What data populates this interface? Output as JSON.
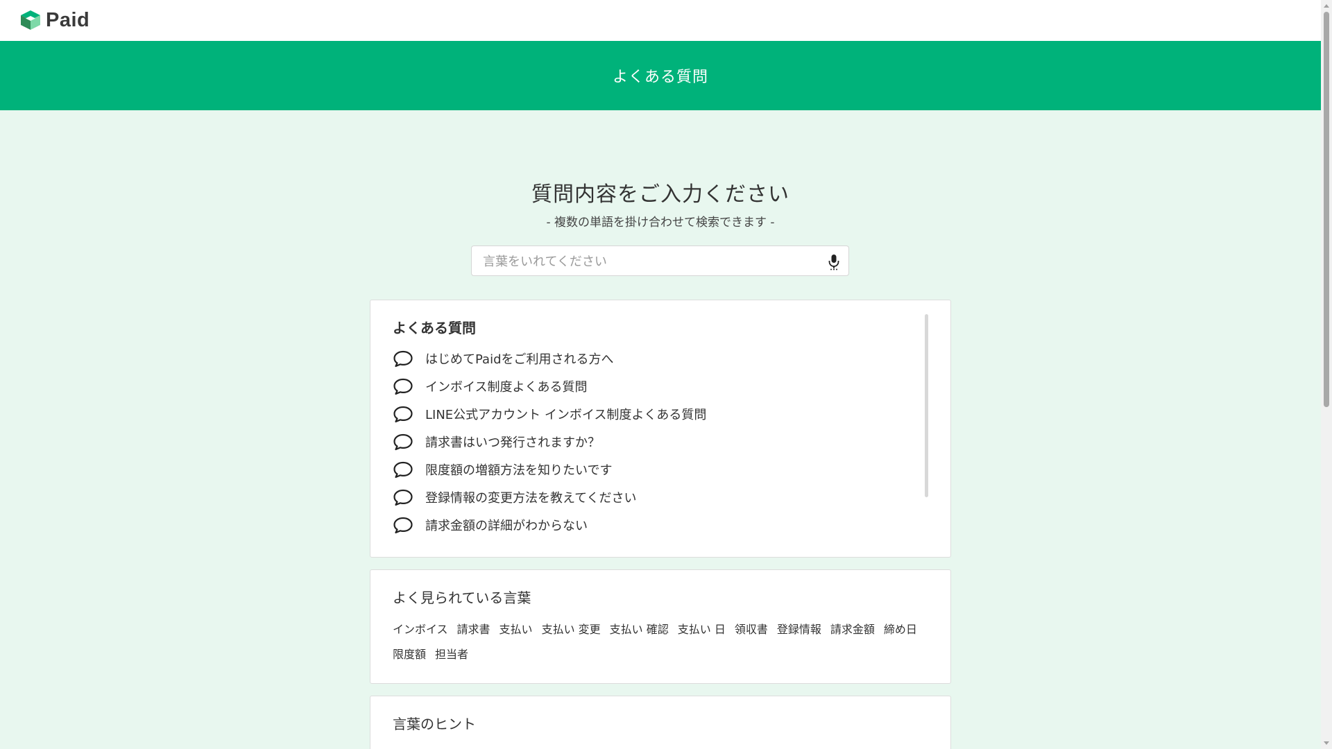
{
  "app": {
    "logo_text": "Paid",
    "brand_color": "#00b27a",
    "background_color": "#e8f7ef"
  },
  "header": {
    "title": "よくある質問"
  },
  "search": {
    "title": "質問内容をご入力ください",
    "subtitle": "- 複数の単語を掛け合わせて検索できます -",
    "placeholder": "言葉をいれてください",
    "value": "",
    "mic_icon": "microphone-icon"
  },
  "faq": {
    "heading": "よくある質問",
    "icon": "speech-bubble-icon",
    "items": [
      "はじめてPaidをご利用される方へ",
      "インボイス制度よくある質問",
      "LINE公式アカウント インボイス制度よくある質問",
      "請求書はいつ発行されますか？",
      "限度額の増額方法を知りたいです",
      "登録情報の変更方法を教えてください",
      "請求金額の詳細がわからない"
    ]
  },
  "popular_words": {
    "heading": "よく見られている言葉",
    "keywords": [
      "インボイス",
      "請求書",
      "支払い",
      "支払い 変更",
      "支払い 確認",
      "支払い 日",
      "領収書",
      "登録情報",
      "請求金額",
      "締め日",
      "限度額",
      "担当者"
    ]
  },
  "hints": {
    "heading": "言葉のヒント"
  }
}
